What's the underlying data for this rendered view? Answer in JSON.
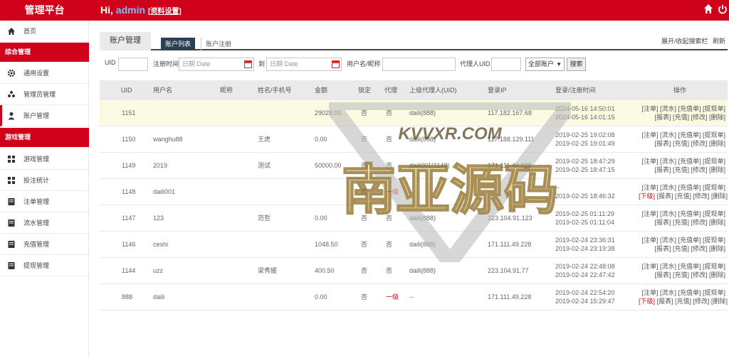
{
  "header": {
    "brand": "管理平台",
    "greeting": "Hi,",
    "username": "admin",
    "profile_link": "[资料设置]"
  },
  "sidebar": {
    "home": "首页",
    "group1": "综合管理",
    "items1": [
      "通用设置",
      "管理员管理",
      "账户管理"
    ],
    "group2": "游戏管理",
    "items2": [
      "游戏管理",
      "投注统计",
      "注单管理",
      "流水管理",
      "充值管理",
      "提现管理"
    ]
  },
  "tabs": {
    "main": "账户管理",
    "list": "账户列表",
    "register": "账户注册",
    "toggle": "展开/收起搜索栏",
    "refresh": "刷新"
  },
  "filters": {
    "uid_label": "UID",
    "reg_time_label": "注册时间",
    "date_placeholder": "日期 Date",
    "to_label": "到",
    "name_label": "用户名/昵称",
    "agent_uid_label": "代理人UID",
    "status_select": "全部账户",
    "search_button": "搜索"
  },
  "table": {
    "headers": [
      "UID",
      "用户名",
      "昵称",
      "姓名/手机号",
      "金额",
      "锁定",
      "代理",
      "上级代理人(UID)",
      "登录IP",
      "登录/注册时间",
      "操作"
    ],
    "rows": [
      {
        "uid": "1151",
        "username": "",
        "nickname": "",
        "name": "",
        "amount": "29028.00",
        "locked": "否",
        "agent": "否",
        "parent": "daili(888)",
        "ip": "117.182.167.68",
        "t1": "2024-05-16 14:50:01",
        "t2": "2024-05-16 14:01:15",
        "ops1": "[注单] [流水] [充值单] [提现单]",
        "ops2": "[报表] [充值] [修改] [删除]",
        "sub": ""
      },
      {
        "uid": "1150",
        "username": "wanghu88",
        "nickname": "",
        "name": "王虎",
        "amount": "0.00",
        "locked": "否",
        "agent": "否",
        "parent": "daili(888)",
        "ip": "117.188.129.111",
        "t1": "2019-02-25 19:02:08",
        "t2": "2019-02-25 19:01:49",
        "ops1": "[注单] [流水] [充值单] [提现单]",
        "ops2": "[报表] [充值] [修改] [删除]",
        "sub": ""
      },
      {
        "uid": "1149",
        "username": "2019",
        "nickname": "",
        "name": "测试",
        "amount": "50000.00",
        "locked": "否",
        "agent": "否",
        "parent": "daili001(1148)",
        "ip": "171.111.49.228",
        "t1": "2019-02-25 18:47:29",
        "t2": "2019-02-25 18:47:15",
        "ops1": "[注单] [流水] [充值单] [提现单]",
        "ops2": "[报表] [充值] [修改] [删除]",
        "sub": ""
      },
      {
        "uid": "1148",
        "username": "daili001",
        "nickname": "",
        "name": "",
        "amount": "",
        "locked": "否",
        "agent": "一级",
        "parent": "--",
        "ip": "",
        "t1": "--",
        "t2": "2019-02-25 18:46:32",
        "ops1": "[注单] [流水] [充值单] [提现单]",
        "ops2": "[报表] [充值] [修改] [删除]",
        "sub": "[下级]"
      },
      {
        "uid": "1147",
        "username": "123",
        "nickname": "",
        "name": "范哲",
        "amount": "0.00",
        "locked": "否",
        "agent": "否",
        "parent": "daili(888)",
        "ip": "223.104.91.123",
        "t1": "2019-02-25 01:11:29",
        "t2": "2019-02-25 01:11:04",
        "ops1": "[注单] [流水] [充值单] [提现单]",
        "ops2": "[报表] [充值] [修改] [删除]",
        "sub": ""
      },
      {
        "uid": "1146",
        "username": "ceshi",
        "nickname": "",
        "name": "",
        "amount": "1048.50",
        "locked": "否",
        "agent": "否",
        "parent": "daili(888)",
        "ip": "171.111.49.228",
        "t1": "2019-02-24 23:36:31",
        "t2": "2019-02-24 23:19:38",
        "ops1": "[注单] [流水] [充值单] [提现单]",
        "ops2": "[报表] [充值] [修改] [删除]",
        "sub": ""
      },
      {
        "uid": "1144",
        "username": "uzz",
        "nickname": "",
        "name": "梁秀媛",
        "amount": "400.50",
        "locked": "否",
        "agent": "否",
        "parent": "daili(888)",
        "ip": "223.104.91.77",
        "t1": "2019-02-24 22:48:08",
        "t2": "2019-02-24 22:47:42",
        "ops1": "[注单] [流水] [充值单] [提现单]",
        "ops2": "[报表] [充值] [修改] [删除]",
        "sub": ""
      },
      {
        "uid": "888",
        "username": "daili",
        "nickname": "",
        "name": "",
        "amount": "0.00",
        "locked": "否",
        "agent": "一级",
        "parent": "--",
        "ip": "171.111.49.228",
        "t1": "2019-02-24 22:54:20",
        "t2": "2019-02-24 15:29:47",
        "ops1": "[注单] [流水] [充值单] [提现单]",
        "ops2": "[报表] [充值] [修改] [删除]",
        "sub": "[下级]"
      }
    ]
  },
  "watermark": {
    "top_text": "KVVXR.COM",
    "main_text": "南亚源码"
  },
  "colors": {
    "brand_red": "#d0021b",
    "sub_tab": "#2d3f55",
    "highlight_row": "#fbfbe3"
  }
}
